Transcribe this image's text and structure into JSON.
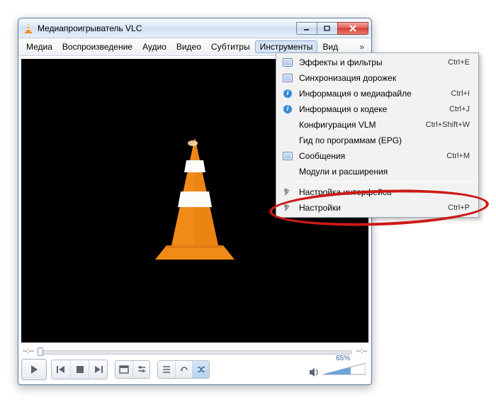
{
  "window": {
    "title": "Медиапроигрыватель VLC"
  },
  "menubar": {
    "items": [
      "Медиа",
      "Воспроизведение",
      "Аудио",
      "Видео",
      "Субтитры",
      "Инструменты",
      "Вид"
    ],
    "active_index": 5,
    "overflow_glyph": "»"
  },
  "playback": {
    "time_elapsed": "--:--",
    "time_total": "--:--",
    "volume_percent": "65%"
  },
  "dropdown": {
    "items": [
      {
        "icon": "sq",
        "label": "Эффекты и фильтры",
        "shortcut": "Ctrl+E"
      },
      {
        "icon": "sq",
        "label": "Синхронизация дорожек",
        "shortcut": ""
      },
      {
        "icon": "info",
        "label": "Информация о медиафайле",
        "shortcut": "Ctrl+I"
      },
      {
        "icon": "info",
        "label": "Информация о кодеке",
        "shortcut": "Ctrl+J"
      },
      {
        "icon": "",
        "label": "Конфигурация VLM",
        "shortcut": "Ctrl+Shift+W"
      },
      {
        "icon": "",
        "label": "Гид по программам (EPG)",
        "shortcut": ""
      },
      {
        "icon": "sq",
        "label": "Сообщения",
        "shortcut": "Ctrl+M"
      },
      {
        "icon": "",
        "label": "Модули и расширения",
        "shortcut": ""
      },
      {
        "sep": true
      },
      {
        "icon": "tools",
        "label": "Настройка интерфейса",
        "shortcut": ""
      },
      {
        "icon": "tools",
        "label": "Настройки",
        "shortcut": "Ctrl+P"
      }
    ]
  }
}
